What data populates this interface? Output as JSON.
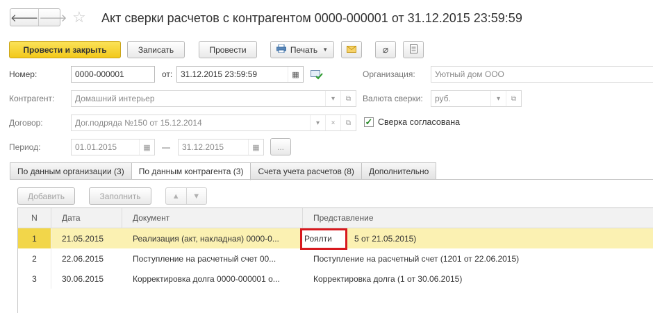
{
  "nav": {
    "back_icon": "arrow-left-icon",
    "forward_icon": "arrow-right-icon",
    "back": "🡐",
    "forward": "🡒"
  },
  "title": "Акт сверки расчетов с контрагентом 0000-000001 от 31.12.2015 23:59:59",
  "toolbar": {
    "post_close": "Провести и закрыть",
    "save": "Записать",
    "post": "Провести",
    "print": "Печать",
    "print_icon": "printer-icon",
    "mail_icon": "envelope-icon",
    "attach_icon": "paperclip-icon",
    "report_icon": "document-icon"
  },
  "form": {
    "number_label": "Номер:",
    "number_value": "0000-000001",
    "from_label": "от:",
    "date_value": "31.12.2015 23:59:59",
    "org_label": "Организация:",
    "org_value": "Уютный дом ООО",
    "counterparty_label": "Контрагент:",
    "counterparty_value": "Домашний интерьер",
    "currency_label": "Валюта сверки:",
    "currency_value": "руб.",
    "contract_label": "Договор:",
    "contract_value": "Дог.подряда №150 от 15.12.2014",
    "agreed_label": "Сверка согласована",
    "agreed_checked": true,
    "period_label": "Период:",
    "period_from": "01.01.2015",
    "period_dash": "—",
    "period_to": "31.12.2015",
    "period_more": "..."
  },
  "tabs": [
    {
      "label": "По данным организации (3)",
      "active": false
    },
    {
      "label": "По данным контрагента (3)",
      "active": true
    },
    {
      "label": "Счета учета расчетов (8)",
      "active": false
    },
    {
      "label": "Дополнительно",
      "active": false
    }
  ],
  "table_toolbar": {
    "add": "Добавить",
    "fill": "Заполнить",
    "up_icon": "arrow-up-icon",
    "down_icon": "arrow-down-icon"
  },
  "table": {
    "columns": [
      "N",
      "Дата",
      "Документ",
      "Представление"
    ],
    "rows": [
      {
        "n": "1",
        "date": "21.05.2015",
        "doc": "Реализация (акт, накладная) 0000-0...",
        "repr": "Реализация (акт, накладная) 0000-000005 от 21.05.2015)",
        "repr_visible": "5 от 21.05.2015)"
      },
      {
        "n": "2",
        "date": "22.06.2015",
        "doc": "Поступление на расчетный счет 00...",
        "repr": "Поступление на расчетный счет (1201 от 22.06.2015)"
      },
      {
        "n": "3",
        "date": "30.06.2015",
        "doc": "Корректировка долга 0000-000001 о...",
        "repr": "Корректировка долга (1 от 30.06.2015)"
      }
    ]
  },
  "highlight_text": "Роялти",
  "colors": {
    "primary": "#f2c81a",
    "selected_row": "#fbf1b2",
    "highlight_border": "#d7191e",
    "check": "#2a8a2a"
  }
}
